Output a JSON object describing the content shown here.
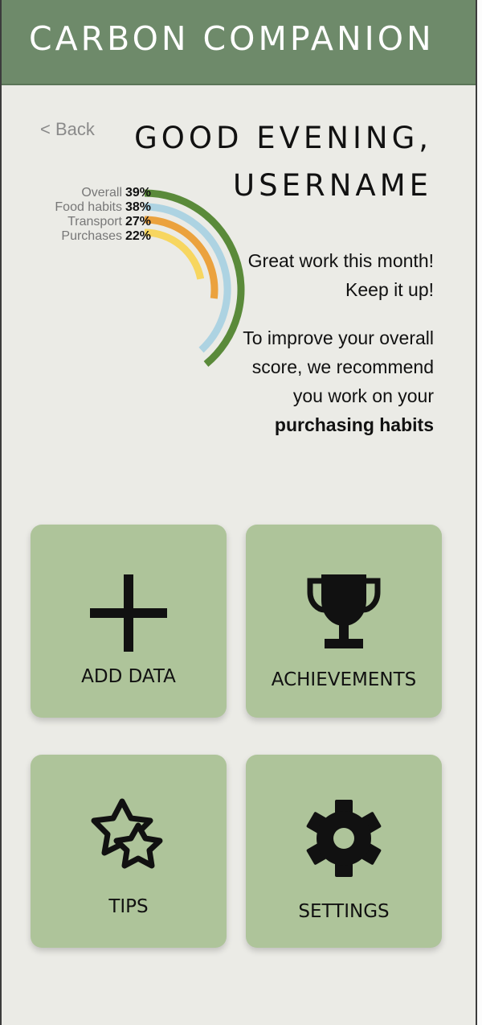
{
  "header": {
    "title": "CARBON COMPANION"
  },
  "nav": {
    "back_label": "< Back"
  },
  "greeting": {
    "line1": "GOOD EVENING,",
    "line2": "USERNAME"
  },
  "chart_data": {
    "type": "radial-bar",
    "series": [
      {
        "name": "Overall",
        "value": 39,
        "label": "39%",
        "color": "#5a8a3a"
      },
      {
        "name": "Food habits",
        "value": 38,
        "label": "38%",
        "color": "#add3e2"
      },
      {
        "name": "Transport",
        "value": 27,
        "label": "27%",
        "color": "#eba23e"
      },
      {
        "name": "Purchases",
        "value": 22,
        "label": "22%",
        "color": "#f7d660"
      }
    ]
  },
  "message": {
    "praise": "Great work this month! Keep it up!",
    "recommend_prefix": "To improve your overall score, we recommend you work on your",
    "recommend_focus": "purchasing habits"
  },
  "tiles": [
    {
      "label": "ADD DATA",
      "icon": "plus-icon"
    },
    {
      "label": "ACHIEVEMENTS",
      "icon": "trophy-icon"
    },
    {
      "label": "TIPS",
      "icon": "stars-icon"
    },
    {
      "label": "SETTINGS",
      "icon": "gear-icon"
    }
  ]
}
